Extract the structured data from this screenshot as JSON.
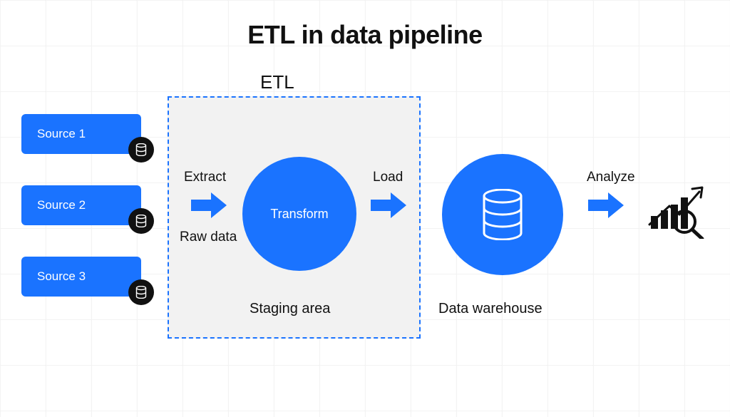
{
  "title": "ETL in data pipeline",
  "etl_label": "ETL",
  "sources": {
    "s1": "Source 1",
    "s2": "Source 2",
    "s3": "Source 3"
  },
  "stages": {
    "extract": "Extract",
    "raw_data": "Raw data",
    "transform": "Transform",
    "load": "Load",
    "staging_area": "Staging area"
  },
  "warehouse_label": "Data warehouse",
  "analyze_label": "Analyze"
}
